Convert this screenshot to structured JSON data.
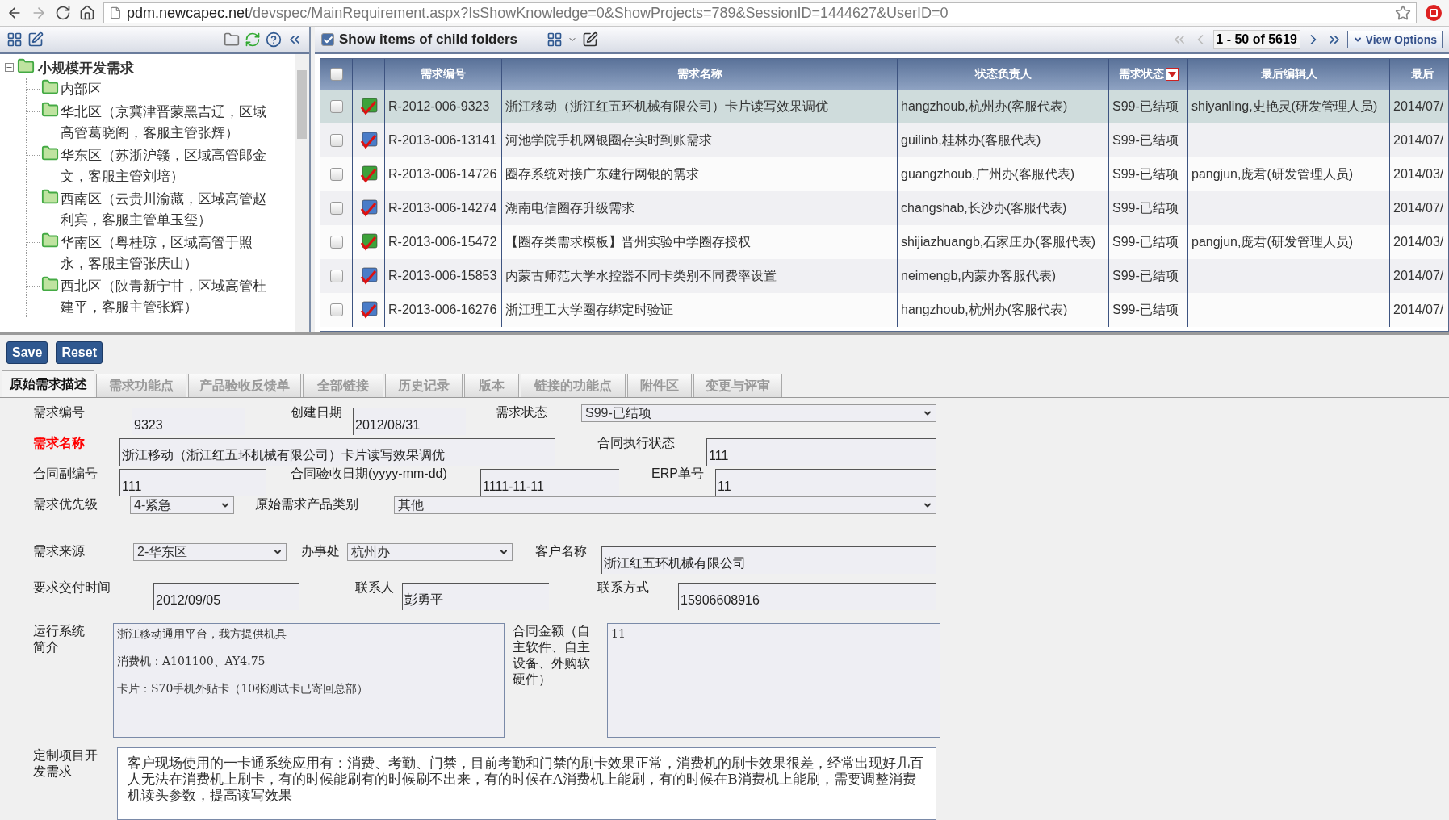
{
  "browser": {
    "url_host": "pdm.newcapec.net",
    "url_path": "/devspec/MainRequirement.aspx?IsShowKnowledge=0&ShowProjects=789&SessionID=1444627&UserID=0"
  },
  "tree": {
    "label": "小规模开发需求",
    "expanded": true,
    "children": [
      {
        "label": "内部区"
      },
      {
        "label": "华北区（京冀津晋蒙黑吉辽，区域高管葛晓阁，客服主管张辉）"
      },
      {
        "label": "华东区（苏浙沪赣，区域高管郎金文，客服主管刘培）"
      },
      {
        "label": "西南区（云贵川渝藏，区域高管赵利宾，客服主管单玉玺）"
      },
      {
        "label": "华南区（粤桂琼，区域高管于照永，客服主管张庆山）"
      },
      {
        "label": "西北区（陕青新宁甘，区域高管杜建平，客服主管张辉）"
      }
    ]
  },
  "grid_toolbar": {
    "show_child_items": {
      "label": "Show items of child folders",
      "checked": true
    },
    "pager": "1 - 50 of 5619",
    "view_options": "View Options"
  },
  "table": {
    "select_all_checked": false,
    "columns": [
      "需求编号",
      "需求名称",
      "状态负责人",
      "需求状态",
      "最后编辑人",
      "最后"
    ],
    "rows": [
      {
        "kind": "green",
        "selected": true,
        "checked": false,
        "cells": [
          "R-2012-006-9323",
          "浙江移动（浙江红五环机械有限公司）卡片读写效果调优",
          "hangzhoub,杭州办(客服代表)",
          "S99-已结项",
          "shiyanling,史艳灵(研发管理人员)",
          "2014/07/"
        ]
      },
      {
        "kind": "blue",
        "selected": false,
        "checked": false,
        "cells": [
          "R-2013-006-13141",
          "河池学院手机网银圈存实时到账需求",
          "guilinb,桂林办(客服代表)",
          "S99-已结项",
          "",
          "2014/07/"
        ]
      },
      {
        "kind": "green",
        "selected": false,
        "checked": false,
        "cells": [
          "R-2013-006-14726",
          "圈存系统对接广东建行网银的需求",
          "guangzhoub,广州办(客服代表)",
          "S99-已结项",
          "pangjun,庞君(研发管理人员)",
          "2014/03/"
        ]
      },
      {
        "kind": "blue",
        "selected": false,
        "checked": false,
        "cells": [
          "R-2013-006-14274",
          "湖南电信圈存升级需求",
          "changshab,长沙办(客服代表)",
          "S99-已结项",
          "",
          "2014/07/"
        ]
      },
      {
        "kind": "green",
        "selected": false,
        "checked": false,
        "cells": [
          "R-2013-006-15472",
          "【圈存类需求模板】晋州实验中学圈存授权",
          "shijiazhuangb,石家庄办(客服代表)",
          "S99-已结项",
          "pangjun,庞君(研发管理人员)",
          "2014/03/"
        ]
      },
      {
        "kind": "blue",
        "selected": false,
        "checked": false,
        "cells": [
          "R-2013-006-15853",
          "内蒙古师范大学水控器不同卡类别不同费率设置",
          "neimengb,内蒙办客服代表)",
          "S99-已结项",
          "",
          "2014/07/"
        ]
      },
      {
        "kind": "blue",
        "selected": false,
        "checked": false,
        "cells": [
          "R-2013-006-16276",
          "浙江理工大学圈存绑定时验证",
          "hangzhoub,杭州办(客服代表)",
          "S99-已结项",
          "",
          "2014/07/"
        ]
      }
    ]
  },
  "buttons": [
    "Save",
    "Reset"
  ],
  "tabs": [
    {
      "label": "原始需求描述",
      "selected": true
    },
    {
      "label": "需求功能点",
      "selected": false
    },
    {
      "label": "产品验收反馈单",
      "selected": false
    },
    {
      "label": "全部链接",
      "selected": false
    },
    {
      "label": "历史记录",
      "selected": false
    },
    {
      "label": "版本",
      "selected": false
    },
    {
      "label": "链接的功能点",
      "selected": false
    },
    {
      "label": "附件区",
      "selected": false
    },
    {
      "label": "变更与评审",
      "selected": false
    }
  ],
  "form": [
    [
      {
        "kind": "field",
        "label": "需求编号",
        "value": "9323"
      },
      {
        "kind": "field",
        "label": "创建日期",
        "value": "2012/08/31"
      },
      {
        "kind": "select",
        "label": "需求状态",
        "value": "S99-已结项"
      }
    ],
    [
      {
        "kind": "field",
        "label": "需求名称",
        "required": true,
        "value": "浙江移动（浙江红五环机械有限公司）卡片读写效果调优"
      },
      {
        "kind": "field",
        "label": "合同执行状态",
        "value": "111"
      }
    ],
    [
      {
        "kind": "field",
        "label": "合同副编号",
        "value": "111"
      },
      {
        "kind": "field",
        "label": "合同验收日期(yyyy-mm-dd)",
        "value": "1111-11-11"
      },
      {
        "kind": "field",
        "label": "ERP单号",
        "value": "11"
      }
    ],
    [
      {
        "kind": "select",
        "label": "需求优先级",
        "value": "4-紧急"
      },
      {
        "kind": "select",
        "label": "原始需求产品类别",
        "value": "其他"
      }
    ],
    [
      {
        "kind": "select",
        "label": "需求来源",
        "value": "2-华东区"
      },
      {
        "kind": "select",
        "label": "办事处",
        "value": "杭州办"
      },
      {
        "kind": "field",
        "label": "客户名称",
        "value": "浙江红五环机械有限公司"
      }
    ],
    [
      {
        "kind": "field",
        "label": "要求交付时间",
        "value": "2012/09/05"
      },
      {
        "kind": "field",
        "label": "联系人",
        "value": "彭勇平"
      },
      {
        "kind": "field",
        "label": "联系方式",
        "value": "15906608916"
      }
    ],
    [
      {
        "kind": "textarea",
        "label": "运行系统简介",
        "lines": [
          "浙江移动通用平台，我方提供机具",
          "消费机：A101100、AY4.75",
          "卡片：S70手机外贴卡（10张测试卡已寄回总部）"
        ]
      },
      {
        "kind": "textarea",
        "label": "合同金额（自主软件、自主设备、外购软硬件）",
        "lines": [
          "11"
        ]
      }
    ],
    [
      {
        "kind": "textarea",
        "label": "定制项目开发需求",
        "lines": [
          "客户现场使用的一卡通系统应用有：消费、考勤、门禁，目前考勤和门禁的刷卡效果正常，消费机的刷卡效果很差，经常出现好几百人无法在消费机上刷卡，有的时候能刷有的时候刷不出来，有的时候在A消费机上能刷，有的时候在B消费机上能刷，需要调整消费机读头参数，提高读写效果"
        ]
      }
    ]
  ]
}
